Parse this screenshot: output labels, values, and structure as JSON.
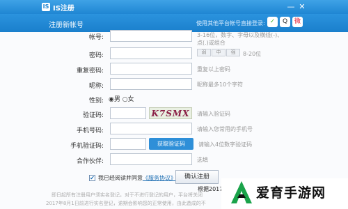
{
  "window": {
    "app_icon": "IS",
    "title": "IS注册",
    "minimize_icon": "minimize-icon",
    "close_icon": "close-icon"
  },
  "header": {
    "title": "注册新帐号",
    "other_login_hint": "使用其他平台帐号直接登录:",
    "social": {
      "wechat": "✓",
      "qq": "Q",
      "weibo": "微"
    }
  },
  "form": {
    "account": {
      "label": "帐号:",
      "value": "",
      "tip_line1": "3-16位，数字、字母以及横线(-)、",
      "tip_line2": "点(.)或组合"
    },
    "password": {
      "label": "密码:",
      "value": "",
      "strength": [
        "弱",
        "中",
        "强"
      ],
      "tip": "8-20位"
    },
    "confirm_password": {
      "label": "重复密码:",
      "value": "",
      "tip": "重复以上密码"
    },
    "nickname": {
      "label": "昵称:",
      "value": "",
      "tip": "昵称最多10个字符"
    },
    "gender": {
      "label": "性别:",
      "options": [
        "男",
        "女"
      ],
      "selected": "男"
    },
    "captcha": {
      "label": "验证码:",
      "value": "",
      "image_text": "K7SMX",
      "tip": "请输入验证码"
    },
    "phone": {
      "label": "手机号码:",
      "value": "",
      "tip": "请输入您常用的手机号"
    },
    "sms_code": {
      "label": "手机验证码:",
      "value": "",
      "button": "获取验证码",
      "tip": "请输入4位数字验证码"
    },
    "partner": {
      "label": "合作伙伴:",
      "value": "",
      "tip": "选填"
    }
  },
  "agreement": {
    "checked_mark": "✔",
    "text": "我已经阅读并同意",
    "link": "《服务协议》"
  },
  "confirm_button": "确认注册",
  "notice": {
    "bold": "根据2017年6月1日起颁布并实施的《网络",
    "line1": "即日起所有注册用户须实名登记，对于不进行登记的用户，平台将关闭",
    "line2": "2017年8月1日前进行实名登记，逾期会影响您的正常使用，由此造成的不"
  },
  "watermark": {
    "text": "爱育手游网"
  }
}
